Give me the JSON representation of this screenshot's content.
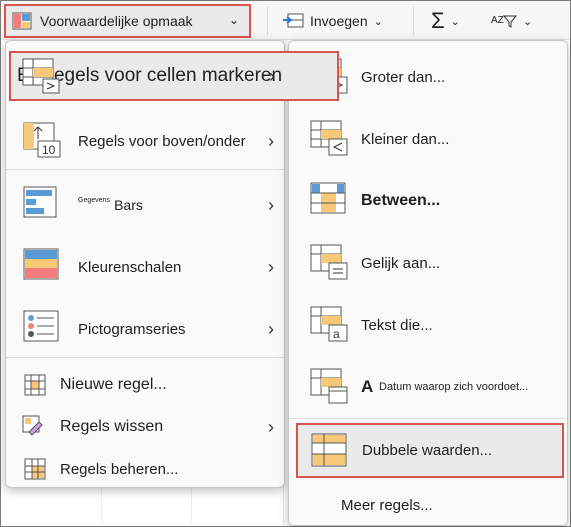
{
  "ribbon": {
    "conditional_formatting": "Voorwaardelijke opmaak",
    "insert": "Invoegen",
    "sum_symbol": "Σ",
    "sort_symbol": "AZ"
  },
  "left_menu": {
    "items": [
      {
        "label": "E] Regels voor cellen markeren",
        "icon": "highlight-cells-icon"
      },
      {
        "label": "Regels voor boven/onder",
        "icon": "top-bottom-icon",
        "badge": "10"
      },
      {
        "label_sup": "Gegevens",
        "label": "Bars",
        "icon": "data-bars-icon"
      },
      {
        "label": "Kleurenschalen",
        "icon": "color-scales-icon"
      },
      {
        "label": "Pictogramseries",
        "icon": "icon-sets-icon"
      },
      {
        "label": "Nieuwe regel...",
        "icon": "new-rule-icon"
      },
      {
        "label": "Regels wissen",
        "icon": "clear-rules-icon"
      },
      {
        "label": "Regels beheren...",
        "icon": "manage-rules-icon"
      }
    ]
  },
  "right_menu": {
    "items": [
      {
        "label": "Groter dan...",
        "icon": "greater-than-icon"
      },
      {
        "label": "Kleiner dan...",
        "icon": "less-than-icon"
      },
      {
        "label": "Between...",
        "icon": "between-icon"
      },
      {
        "label": "Gelijk aan...",
        "icon": "equal-to-icon"
      },
      {
        "label": "Tekst die...",
        "icon": "text-contains-icon"
      },
      {
        "label": "Datum waarop zich voordoet...",
        "icon": "date-occurring-icon"
      },
      {
        "label": "Dubbele waarden...",
        "icon": "duplicate-values-icon"
      },
      {
        "label": "Meer regels...",
        "icon": "more-rules-icon"
      }
    ]
  },
  "colors": {
    "highlight_border": "#d9534f",
    "orange": "#f8c879",
    "blue": "#5b9bd5",
    "red": "#f47c7c"
  }
}
